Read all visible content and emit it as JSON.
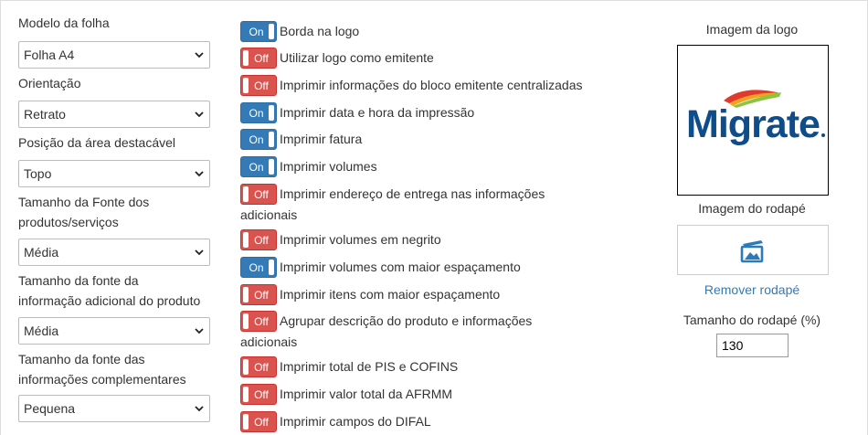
{
  "left": {
    "sheet_model": {
      "label": "Modelo da folha",
      "value": "Folha A4"
    },
    "orientation": {
      "label": "Orientação",
      "value": "Retrato"
    },
    "detachable_area": {
      "label": "Posição da área destacável",
      "value": "Topo"
    },
    "product_font_size": {
      "label_line1": "Tamanho da Fonte dos",
      "label_line2": "produtos/serviços",
      "value": "Média"
    },
    "additional_info_font_size": {
      "label_line1": "Tamanho da fonte da",
      "label_line2": "informação adicional do produto",
      "value": "Média"
    },
    "complementary_info_font_size": {
      "label_line1": "Tamanho da fonte das",
      "label_line2": "informações complementares",
      "value": "Pequena"
    }
  },
  "toggles": {
    "on_label": "On",
    "off_label": "Off",
    "items": [
      {
        "label": "Borda na logo",
        "state": "on"
      },
      {
        "label": "Utilizar logo como emitente",
        "state": "off"
      },
      {
        "label": "Imprimir informações do bloco emitente centralizadas",
        "state": "off"
      },
      {
        "label": "Imprimir data e hora da impressão",
        "state": "on"
      },
      {
        "label": "Imprimir fatura",
        "state": "on"
      },
      {
        "label": "Imprimir volumes",
        "state": "on"
      },
      {
        "label": "Imprimir endereço de entrega nas informações",
        "label_cont": "adicionais",
        "state": "off"
      },
      {
        "label": "Imprimir volumes em negrito",
        "state": "off"
      },
      {
        "label": "Imprimir volumes com maior espaçamento",
        "state": "on"
      },
      {
        "label": "Imprimir itens com maior espaçamento",
        "state": "off"
      },
      {
        "label": "Agrupar descrição do produto e informações",
        "label_cont": "adicionais",
        "state": "off"
      },
      {
        "label": "Imprimir total de PIS e COFINS",
        "state": "off"
      },
      {
        "label": "Imprimir valor total da AFRMM",
        "state": "off"
      },
      {
        "label": "Imprimir campos do DIFAL",
        "state": "off"
      }
    ]
  },
  "right": {
    "logo_caption": "Imagem da logo",
    "logo_text": "Migrate",
    "footer_caption": "Imagem do rodapé",
    "remove_footer_link": "Remover rodapé",
    "footer_size_label": "Tamanho do rodapé (%)",
    "footer_size_value": "130"
  },
  "colors": {
    "toggle_on": "#337ab7",
    "toggle_off": "#d9534f",
    "link": "#337ab7",
    "logo_blue": "#0f4c8a",
    "picture_icon": "#2b7bb9"
  },
  "icons": {
    "select_arrow": "chevron-down-icon",
    "footer_placeholder": "image-icon"
  }
}
